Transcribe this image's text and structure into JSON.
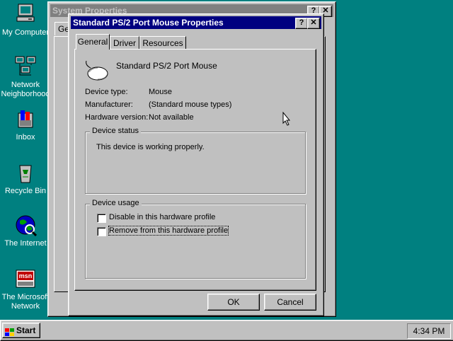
{
  "desktop": {
    "icons": [
      {
        "label": "My Computer",
        "icon": "my-computer-icon"
      },
      {
        "label": "Network Neighborhood",
        "label_line1": "Network",
        "label_line2": "Neighborhood",
        "icon": "network-neighborhood-icon"
      },
      {
        "label": "Inbox",
        "icon": "inbox-icon"
      },
      {
        "label": "Recycle Bin",
        "icon": "recycle-bin-icon"
      },
      {
        "label": "The Internet",
        "icon": "internet-icon"
      },
      {
        "label": "The Microsoft Network",
        "label_line1": "The Microsoft",
        "label_line2": "Network",
        "icon": "msn-icon"
      }
    ]
  },
  "system_properties": {
    "title": "System Properties",
    "tab_partial": "Ge",
    "help_button": "?",
    "close_button": "✕"
  },
  "mouse_properties": {
    "title": "Standard PS/2 Port Mouse Properties",
    "help_button": "?",
    "close_button": "✕",
    "tabs": [
      {
        "label": "General",
        "active": true
      },
      {
        "label": "Driver",
        "active": false
      },
      {
        "label": "Resources",
        "active": false
      }
    ],
    "device_name": "Standard PS/2 Port Mouse",
    "info": {
      "device_type_label": "Device type:",
      "device_type_value": "Mouse",
      "manufacturer_label": "Manufacturer:",
      "manufacturer_value": "(Standard mouse types)",
      "hardware_version_label": "Hardware version:",
      "hardware_version_value": "Not available"
    },
    "device_status": {
      "title": "Device status",
      "text": "This device is working properly."
    },
    "device_usage": {
      "title": "Device usage",
      "options": [
        {
          "label": "Disable in this hardware profile",
          "checked": false
        },
        {
          "label": "Remove from this hardware profile",
          "checked": false
        }
      ]
    },
    "ok_label": "OK",
    "cancel_label": "Cancel"
  },
  "taskbar": {
    "start_label": "Start",
    "clock": "4:34 PM"
  }
}
